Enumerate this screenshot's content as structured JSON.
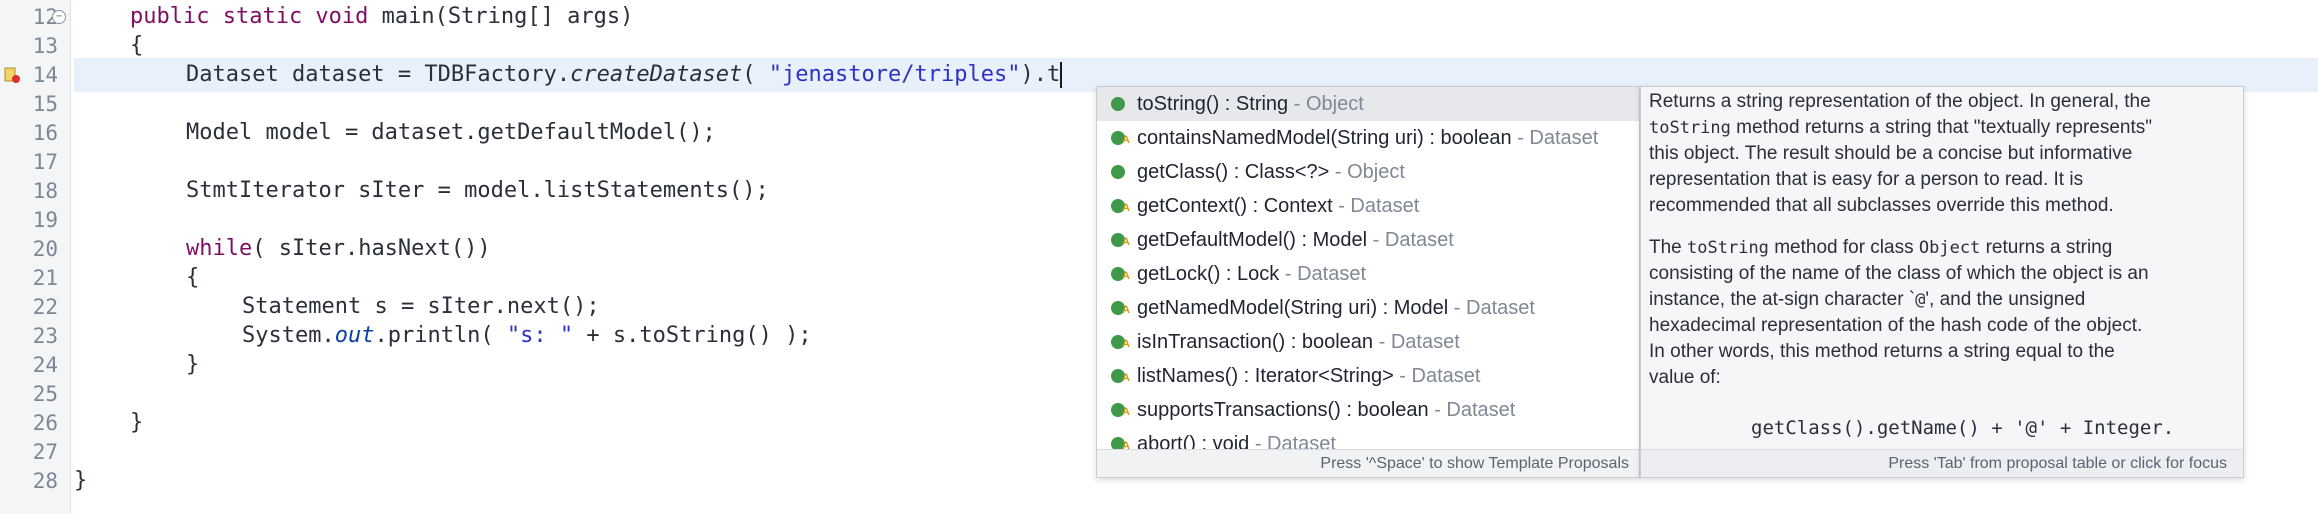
{
  "editor": {
    "line_numbers": [
      "12",
      "13",
      "14",
      "15",
      "16",
      "17",
      "18",
      "19",
      "20",
      "21",
      "22",
      "23",
      "24",
      "25",
      "26",
      "27",
      "28"
    ],
    "lines": {
      "l12": {
        "kw": "public static void",
        "rest": " main(String[] args)"
      },
      "l13": "{",
      "l14": {
        "a": "Dataset dataset = TDBFactory.",
        "it": "createDataset",
        "b": "( ",
        "str": "\"jenastore/triples\"",
        "c": ").t"
      },
      "l16": "Model model = dataset.getDefaultModel();",
      "l18": "StmtIterator sIter = model.listStatements();",
      "l20": {
        "kw": "while",
        "rest": "( sIter.hasNext())"
      },
      "l21": "{",
      "l22": "Statement s = sIter.next();",
      "l23": {
        "a": "System.",
        "field": "out",
        "b": ".println( ",
        "str": "\"s: \"",
        "c": " + s.toString() );"
      },
      "l24": "}",
      "l26": "}",
      "l28": "}"
    }
  },
  "proposals": {
    "items": [
      {
        "name": "toString() : String",
        "owner": " - Object",
        "icon": "public-method-icon"
      },
      {
        "name": "containsNamedModel(String uri) : boolean",
        "owner": " - Dataset",
        "icon": "abstract-method-icon"
      },
      {
        "name": "getClass() : Class<?>",
        "owner": " - Object",
        "icon": "public-method-icon"
      },
      {
        "name": "getContext() : Context",
        "owner": " - Dataset",
        "icon": "abstract-method-icon"
      },
      {
        "name": "getDefaultModel() : Model",
        "owner": " - Dataset",
        "icon": "abstract-method-icon"
      },
      {
        "name": "getLock() : Lock",
        "owner": " - Dataset",
        "icon": "abstract-method-icon"
      },
      {
        "name": "getNamedModel(String uri) : Model",
        "owner": " - Dataset",
        "icon": "abstract-method-icon"
      },
      {
        "name": "isInTransaction() : boolean",
        "owner": " - Dataset",
        "icon": "abstract-method-icon"
      },
      {
        "name": "listNames() : Iterator<String>",
        "owner": " - Dataset",
        "icon": "abstract-method-icon"
      },
      {
        "name": "supportsTransactions() : boolean",
        "owner": " - Dataset",
        "icon": "abstract-method-icon"
      },
      {
        "name": "abort() : void",
        "owner": " - Dataset",
        "icon": "abstract-method-icon"
      }
    ],
    "footer": "Press '^Space' to show Template Proposals"
  },
  "doc": {
    "p1_l1": "Returns a string representation of the object. In general, the",
    "p1_l2_code": "toString",
    "p1_l2_text": " method returns a string that \"textually represents\"",
    "p1_l3": "this object. The result should be a concise but informative",
    "p1_l4": "representation that is easy for a person to read. It is",
    "p1_l5": "recommended that all subclasses override this method.",
    "p2_l1_a": "The ",
    "p2_l1_code1": "toString",
    "p2_l1_b": " method for class ",
    "p2_l1_code2": "Object",
    "p2_l1_c": " returns a string",
    "p2_l2": "consisting of the name of the class of which the object is an",
    "p2_l3_a": "instance, the at-sign character `",
    "p2_l3_code": "@",
    "p2_l3_b": "', and the unsigned",
    "p2_l4": "hexadecimal representation of the hash code of the object.",
    "p2_l5": "In other words, this method returns a string equal to the",
    "p2_l6": "value of:",
    "code": "getClass().getName() + '@' + Integer.",
    "footer": "Press 'Tab' from proposal table or click for focus"
  }
}
